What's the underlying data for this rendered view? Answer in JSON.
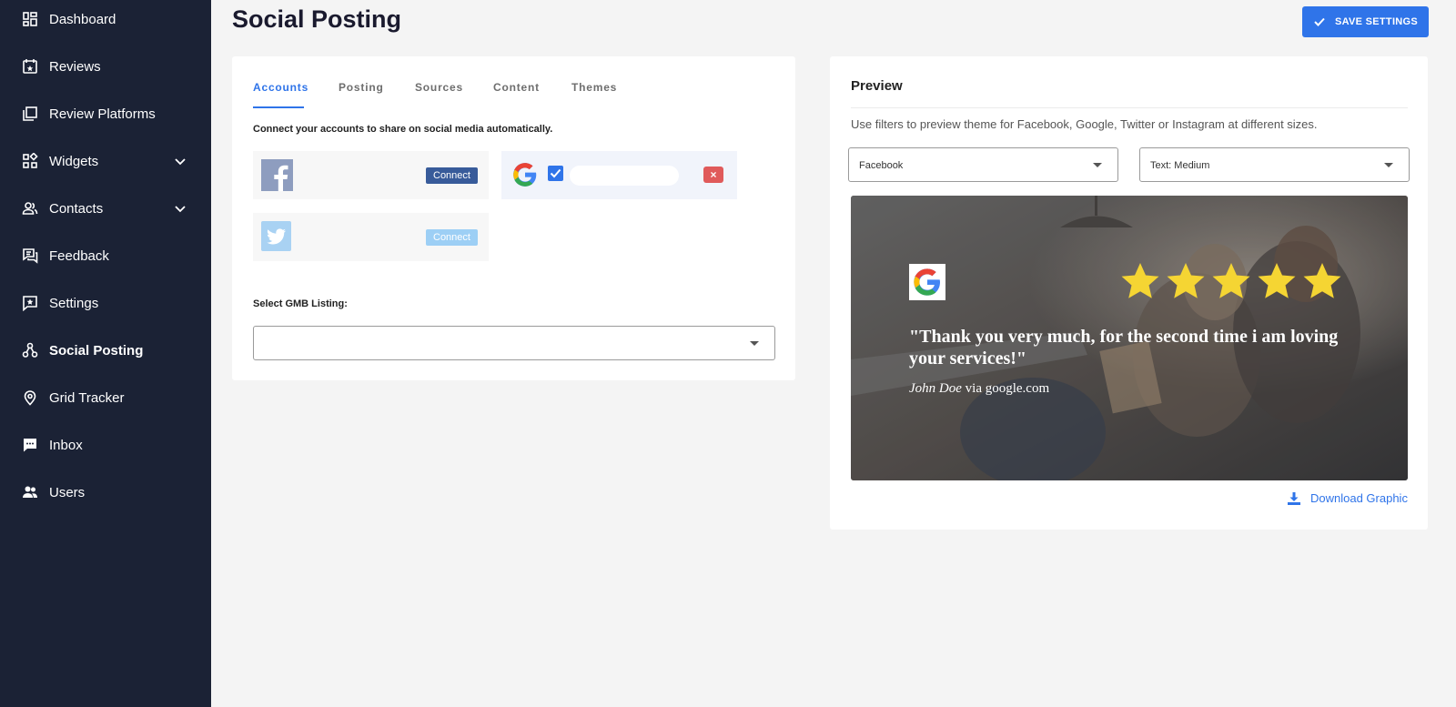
{
  "sidebar": {
    "items": [
      {
        "label": "Dashboard",
        "icon": "dashboard-icon"
      },
      {
        "label": "Reviews",
        "icon": "calendar-star-icon"
      },
      {
        "label": "Review Platforms",
        "icon": "stacked-pages-icon"
      },
      {
        "label": "Widgets",
        "icon": "widgets-icon",
        "expandable": true
      },
      {
        "label": "Contacts",
        "icon": "contacts-icon",
        "expandable": true
      },
      {
        "label": "Feedback",
        "icon": "feedback-icon"
      },
      {
        "label": "Settings",
        "icon": "settings-star-icon"
      },
      {
        "label": "Social Posting",
        "icon": "social-nodes-icon",
        "active": true
      },
      {
        "label": "Grid Tracker",
        "icon": "map-pin-icon"
      },
      {
        "label": "Inbox",
        "icon": "chat-bubble-icon"
      },
      {
        "label": "Users",
        "icon": "users-icon"
      }
    ]
  },
  "header": {
    "title": "Social Posting",
    "save_label": "SAVE SETTINGS"
  },
  "tabs": [
    {
      "label": "Accounts",
      "active": true
    },
    {
      "label": "Posting"
    },
    {
      "label": "Sources"
    },
    {
      "label": "Content"
    },
    {
      "label": "Themes"
    }
  ],
  "accounts": {
    "intro": "Connect your accounts to share on social media automatically.",
    "facebook_connect": "Connect",
    "twitter_connect": "Connect",
    "google_remove": "×",
    "gmb_label": "Select GMB Listing:",
    "gmb_value": ""
  },
  "preview": {
    "title": "Preview",
    "description": "Use filters to preview theme for Facebook, Google, Twitter or Instagram at different sizes.",
    "platform_select": "Facebook",
    "text_size_select": "Text: Medium",
    "quote": "\"Thank you very much, for the second time i am loving your services!\"",
    "author": "John Doe",
    "source": " via google.com",
    "rating": 5,
    "download_label": "Download Graphic"
  },
  "colors": {
    "sidebar_bg": "#1b2235",
    "accent": "#2f74e9",
    "facebook": "#385b9a",
    "twitter": "#9dcff5",
    "remove": "#e05a5a",
    "star": "#f5d533"
  }
}
